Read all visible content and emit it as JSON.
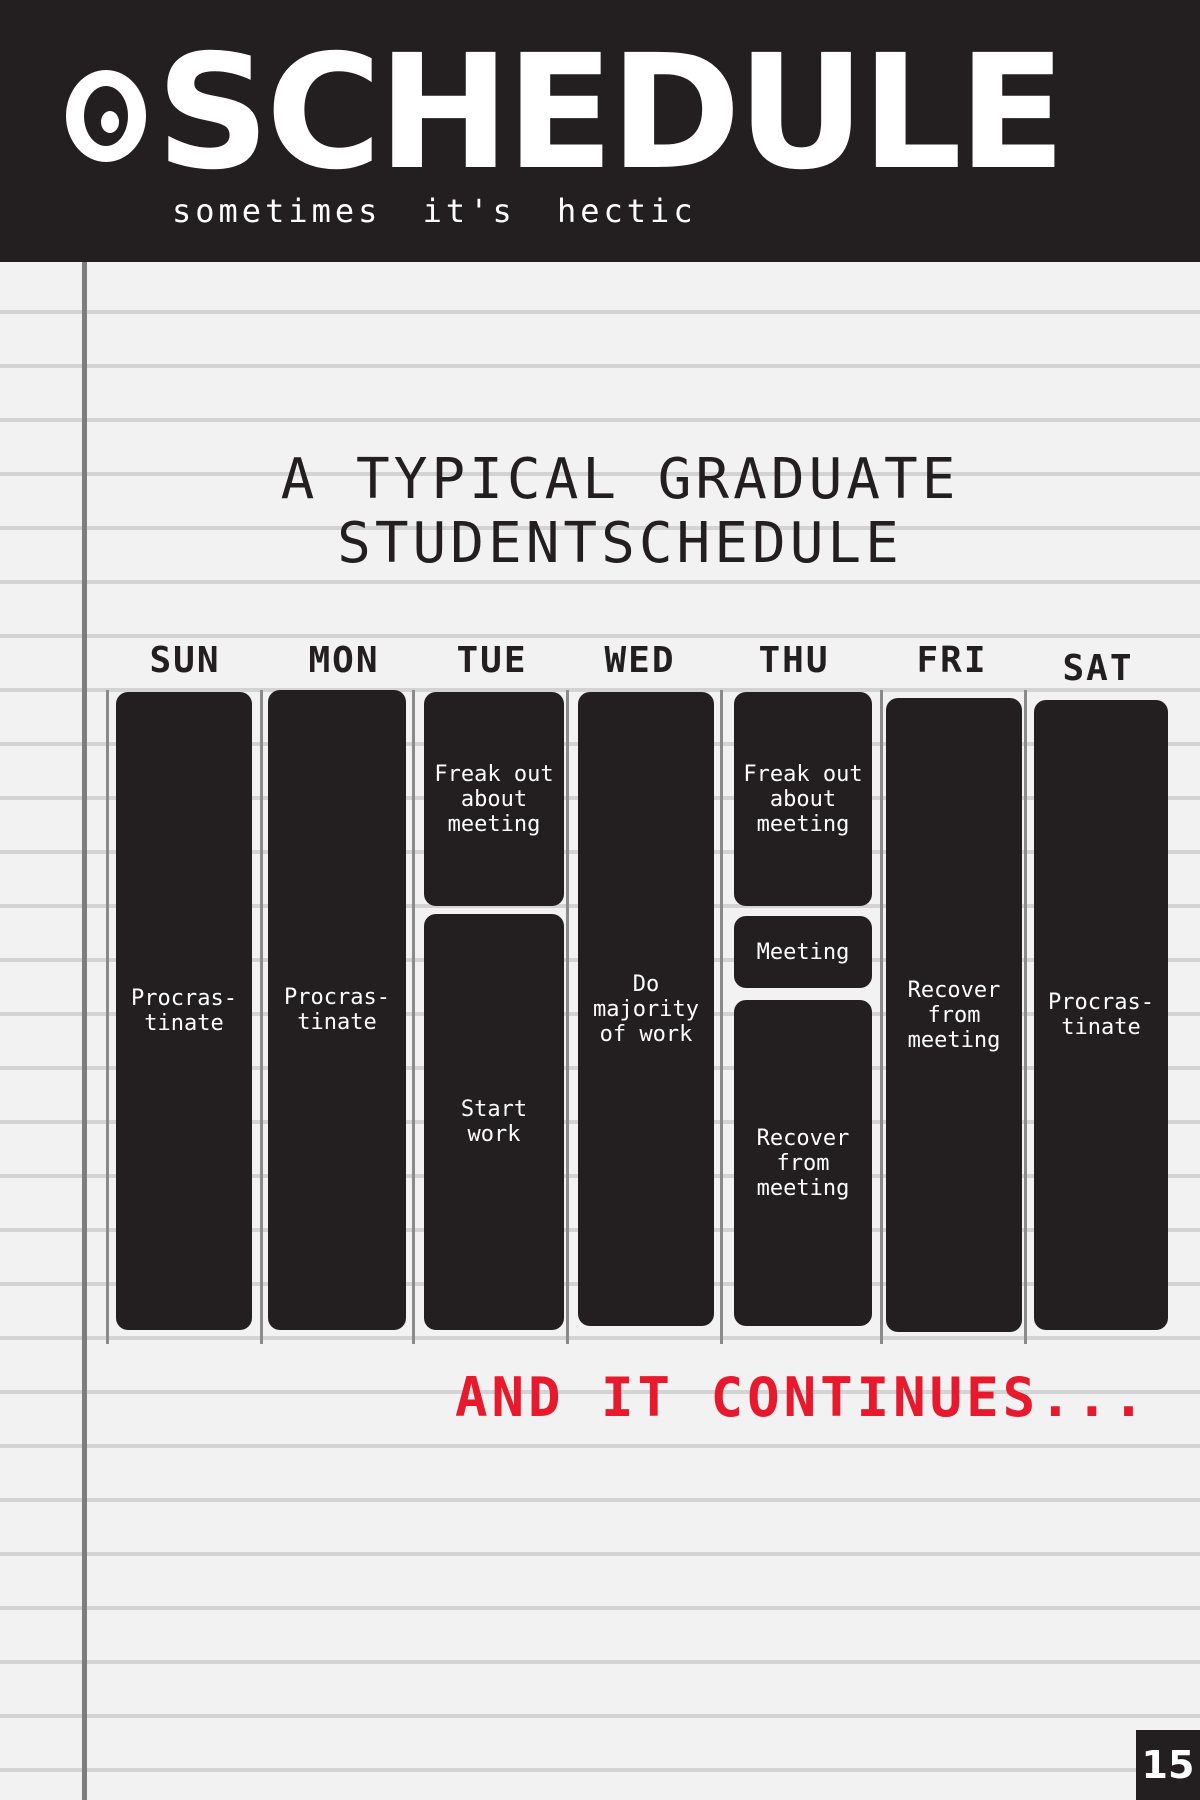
{
  "header": {
    "title": "SCHEDULE",
    "subtitle": "sometimes it's hectic",
    "icon": "round-badge-icon"
  },
  "heading": {
    "line1": "A TYPICAL GRADUATE",
    "line2": "STUDENTSCHEDULE"
  },
  "schedule": {
    "days": [
      {
        "label": "SUN",
        "blocks": [
          {
            "text": "Procras- tinate"
          }
        ]
      },
      {
        "label": "MON",
        "blocks": [
          {
            "text": "Procras- tinate"
          }
        ]
      },
      {
        "label": "TUE",
        "blocks": [
          {
            "text": "Freak out about meeting"
          },
          {
            "text": "Start work"
          }
        ]
      },
      {
        "label": "WED",
        "blocks": [
          {
            "text": "Do majority of work"
          }
        ]
      },
      {
        "label": "THU",
        "blocks": [
          {
            "text": "Freak out about meeting"
          },
          {
            "text": "Meeting"
          },
          {
            "text": "Recover from meeting"
          }
        ]
      },
      {
        "label": "FRI",
        "blocks": [
          {
            "text": "Recover from meeting"
          }
        ]
      },
      {
        "label": "SAT",
        "blocks": [
          {
            "text": "Procras- tinate"
          }
        ]
      }
    ]
  },
  "footer": {
    "continues": "AND IT CONTINUES...",
    "page_number": "15"
  },
  "colors": {
    "header_background": "#231f20",
    "accent_red": "#e8192c",
    "block_fill": "#231f20"
  }
}
